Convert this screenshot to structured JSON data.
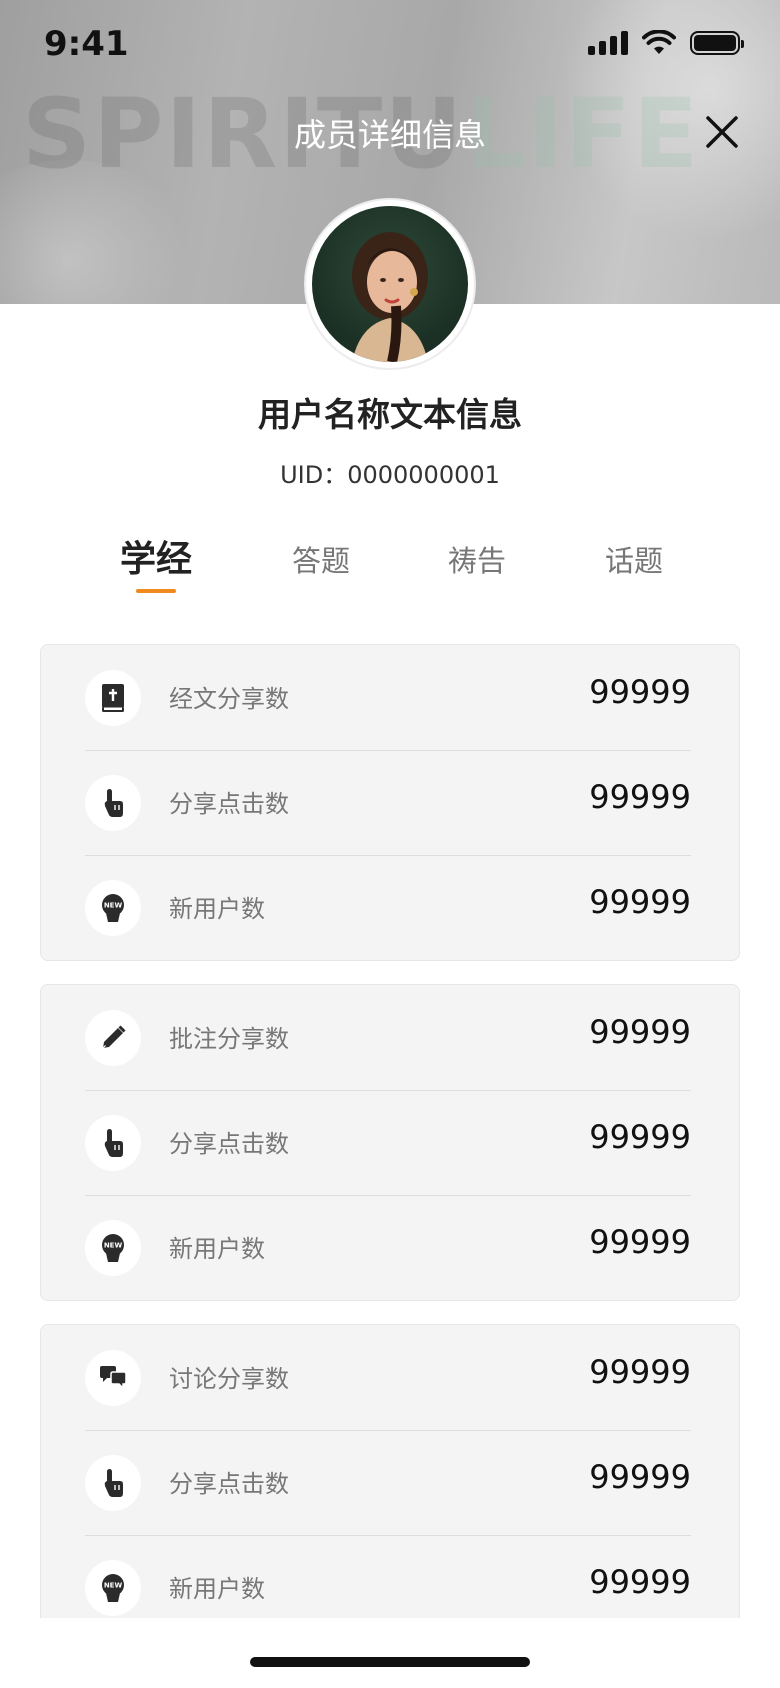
{
  "status_bar": {
    "time": "9:41"
  },
  "header": {
    "title": "成员详细信息",
    "banner_watermark_left": "SPIRITU",
    "banner_watermark_right": "LIFE"
  },
  "profile": {
    "username": "用户名称文本信息",
    "uid": "UID：0000000001"
  },
  "tabs": [
    {
      "label": "学经",
      "active": true
    },
    {
      "label": "答题",
      "active": false
    },
    {
      "label": "祷告",
      "active": false
    },
    {
      "label": "话题",
      "active": false
    }
  ],
  "accent_color": "#f08a1e",
  "cards": [
    {
      "rows": [
        {
          "icon": "bible-icon",
          "label": "经文分享数",
          "value": "99999"
        },
        {
          "icon": "tap-icon",
          "label": "分享点击数",
          "value": "99999"
        },
        {
          "icon": "new-user-icon",
          "label": "新用户数",
          "value": "99999"
        }
      ]
    },
    {
      "rows": [
        {
          "icon": "pencil-icon",
          "label": "批注分享数",
          "value": "99999"
        },
        {
          "icon": "tap-icon",
          "label": "分享点击数",
          "value": "99999"
        },
        {
          "icon": "new-user-icon",
          "label": "新用户数",
          "value": "99999"
        }
      ]
    },
    {
      "rows": [
        {
          "icon": "chat-bubbles-icon",
          "label": "讨论分享数",
          "value": "99999"
        },
        {
          "icon": "tap-icon",
          "label": "分享点击数",
          "value": "99999"
        },
        {
          "icon": "new-user-icon",
          "label": "新用户数",
          "value": "99999"
        }
      ]
    }
  ]
}
